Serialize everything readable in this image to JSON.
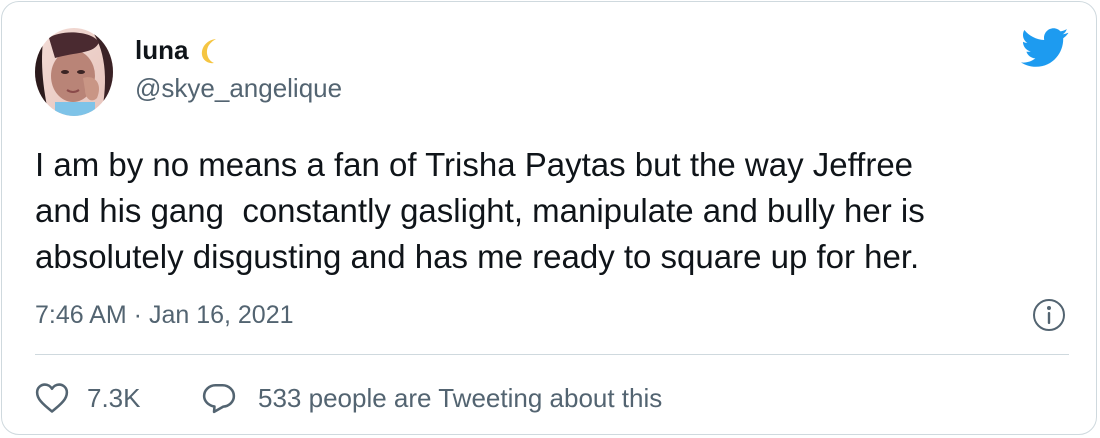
{
  "author": {
    "display_name": "luna",
    "handle": "@skye_angelique"
  },
  "tweet": {
    "text": "I am by no means a fan of Trisha Paytas but the way Jeffree\nand his gang  constantly gaslight, manipulate and bully her is\nabsolutely disgusting and has me ready to square up for her.",
    "timestamp": "7:46 AM · Jan 16, 2021"
  },
  "actions": {
    "like_count": "7.3K",
    "conversation_label": "533 people are Tweeting about this"
  },
  "colors": {
    "brand": "#1d9bf0",
    "text_primary": "#0f1419",
    "text_secondary": "#536471",
    "border": "#cfd9de"
  },
  "icons": {
    "logo": "twitter-bird-icon",
    "info": "info-icon",
    "like": "heart-icon",
    "reply": "speech-bubble-icon",
    "name_emoji": "crescent-moon-icon"
  }
}
